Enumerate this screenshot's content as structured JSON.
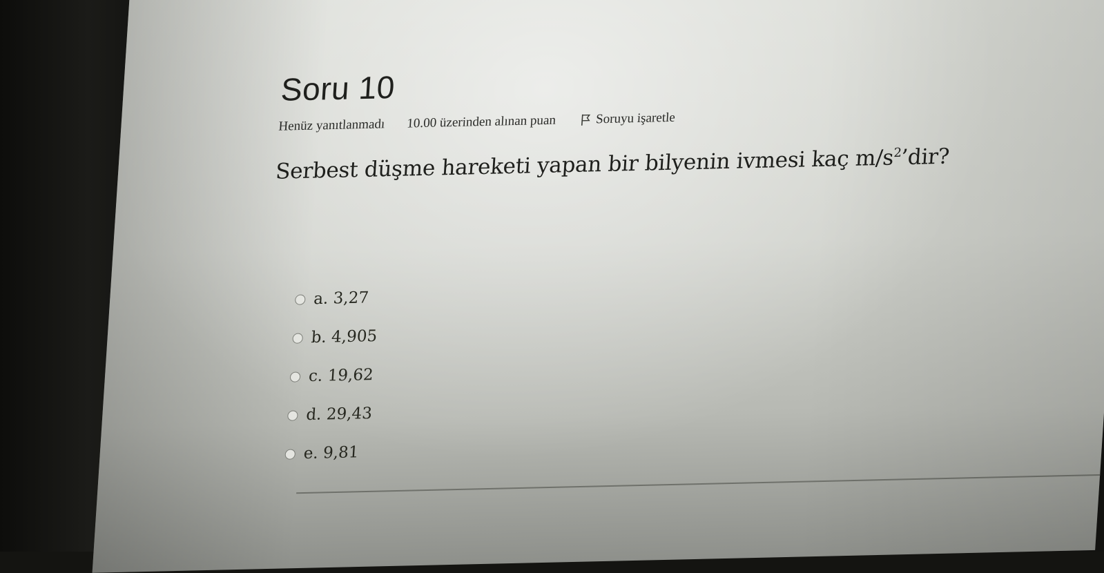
{
  "question": {
    "title": "Soru 10",
    "status": "Henüz yanıtlanmadı",
    "grade": "10.00 üzerinden alınan puan",
    "flag_label": "Soruyu işaretle",
    "text_main": "Serbest düşme hareketi yapan bir bilyenin ivmesi kaç m/s",
    "text_sup": "2",
    "text_tail": "’dir?"
  },
  "answers": [
    {
      "label": "a. 3,27"
    },
    {
      "label": "b. 4,905"
    },
    {
      "label": "c. 19,62"
    },
    {
      "label": "d. 29,43"
    },
    {
      "label": "e. 9,81"
    }
  ]
}
